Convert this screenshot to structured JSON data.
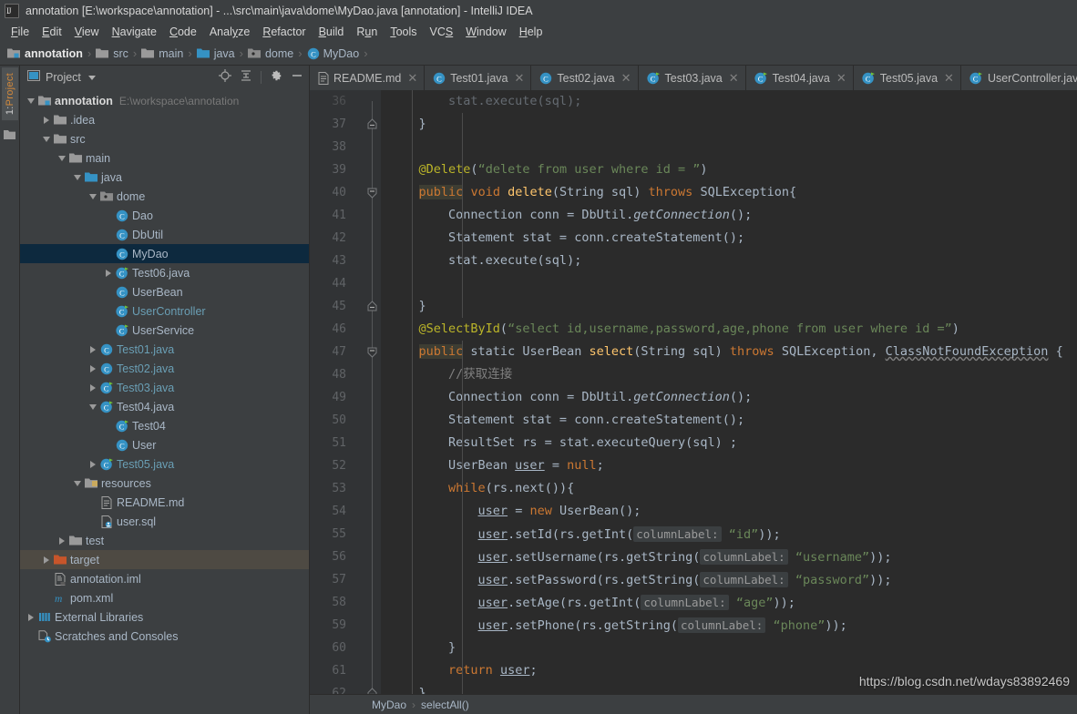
{
  "window": {
    "title": "annotation [E:\\workspace\\annotation] - ...\\src\\main\\java\\dome\\MyDao.java [annotation] - IntelliJ IDEA",
    "logo_icon": "intellij-idea-logo"
  },
  "menubar": {
    "items": [
      {
        "label": "File",
        "mnemonic": "F"
      },
      {
        "label": "Edit",
        "mnemonic": "E"
      },
      {
        "label": "View",
        "mnemonic": "V"
      },
      {
        "label": "Navigate",
        "mnemonic": "N"
      },
      {
        "label": "Code",
        "mnemonic": "C"
      },
      {
        "label": "Analyze",
        "mnemonic": "y"
      },
      {
        "label": "Refactor",
        "mnemonic": "R"
      },
      {
        "label": "Build",
        "mnemonic": "B"
      },
      {
        "label": "Run",
        "mnemonic": "u"
      },
      {
        "label": "Tools",
        "mnemonic": "T"
      },
      {
        "label": "VCS",
        "mnemonic": "S"
      },
      {
        "label": "Window",
        "mnemonic": "W"
      },
      {
        "label": "Help",
        "mnemonic": "H"
      }
    ]
  },
  "navbar": {
    "crumbs": [
      {
        "label": "annotation",
        "icon": "module-icon"
      },
      {
        "label": "src",
        "icon": "folder-icon"
      },
      {
        "label": "main",
        "icon": "folder-icon"
      },
      {
        "label": "java",
        "icon": "source-root-folder-icon"
      },
      {
        "label": "dome",
        "icon": "package-icon"
      },
      {
        "label": "MyDao",
        "icon": "class-icon"
      }
    ],
    "separator": "›"
  },
  "toolstrip": {
    "tab_number": "1:",
    "tab_label": "Project",
    "folder_icon": "folder-icon"
  },
  "project_panel": {
    "title": "Project",
    "dropdown_icon": "chevron-down-icon",
    "actions": [
      {
        "name": "locate-icon",
        "glyph": "⊕"
      },
      {
        "name": "collapse-all-icon",
        "glyph": "⤓"
      },
      {
        "name": "settings-gear-icon",
        "glyph": "⚙"
      },
      {
        "name": "hide-panel-icon",
        "glyph": "—"
      }
    ],
    "tree": [
      {
        "label": "annotation",
        "path": "E:\\workspace\\annotation",
        "depth": 0,
        "arrow": "down",
        "icon": "module-icon",
        "bold": true,
        "state": "normal"
      },
      {
        "label": ".idea",
        "depth": 1,
        "arrow": "right",
        "icon": "folder-icon",
        "state": "normal"
      },
      {
        "label": "src",
        "depth": 1,
        "arrow": "down",
        "icon": "folder-icon",
        "state": "normal"
      },
      {
        "label": "main",
        "depth": 2,
        "arrow": "down",
        "icon": "folder-icon",
        "state": "normal"
      },
      {
        "label": "java",
        "depth": 3,
        "arrow": "down",
        "icon": "source-root-folder-icon",
        "state": "normal"
      },
      {
        "label": "dome",
        "depth": 4,
        "arrow": "down",
        "icon": "package-icon",
        "state": "normal"
      },
      {
        "label": "Dao",
        "depth": 5,
        "arrow": "none",
        "icon": "class-icon",
        "state": "normal"
      },
      {
        "label": "DbUtil",
        "depth": 5,
        "arrow": "none",
        "icon": "class-icon",
        "state": "normal"
      },
      {
        "label": "MyDao",
        "depth": 5,
        "arrow": "none",
        "icon": "class-icon",
        "state": "selected"
      },
      {
        "label": "Test06.java",
        "depth": 5,
        "arrow": "right",
        "icon": "runnable-class-icon",
        "state": "normal"
      },
      {
        "label": "UserBean",
        "depth": 5,
        "arrow": "none",
        "icon": "class-icon",
        "state": "normal"
      },
      {
        "label": "UserController",
        "depth": 5,
        "arrow": "none",
        "icon": "runnable-class-icon",
        "state": "normal",
        "blue": true
      },
      {
        "label": "UserService",
        "depth": 5,
        "arrow": "none",
        "icon": "runnable-class-icon",
        "state": "normal"
      },
      {
        "label": "Test01.java",
        "depth": 4,
        "arrow": "right",
        "icon": "class-icon",
        "state": "normal",
        "blue": true
      },
      {
        "label": "Test02.java",
        "depth": 4,
        "arrow": "right",
        "icon": "class-icon",
        "state": "normal",
        "blue": true
      },
      {
        "label": "Test03.java",
        "depth": 4,
        "arrow": "right",
        "icon": "runnable-class-icon",
        "state": "normal",
        "blue": true
      },
      {
        "label": "Test04.java",
        "depth": 4,
        "arrow": "down",
        "icon": "runnable-class-icon",
        "state": "normal"
      },
      {
        "label": "Test04",
        "depth": 5,
        "arrow": "none",
        "icon": "runnable-class-icon",
        "state": "normal"
      },
      {
        "label": "User",
        "depth": 5,
        "arrow": "none",
        "icon": "class-icon",
        "state": "normal"
      },
      {
        "label": "Test05.java",
        "depth": 4,
        "arrow": "right",
        "icon": "runnable-class-icon",
        "state": "normal",
        "blue": true
      },
      {
        "label": "resources",
        "depth": 3,
        "arrow": "down",
        "icon": "resource-root-folder-icon",
        "state": "normal"
      },
      {
        "label": "README.md",
        "depth": 4,
        "arrow": "none",
        "icon": "markdown-file-icon",
        "state": "normal"
      },
      {
        "label": "user.sql",
        "depth": 4,
        "arrow": "none",
        "icon": "sql-file-icon",
        "state": "normal"
      },
      {
        "label": "test",
        "depth": 2,
        "arrow": "right",
        "icon": "folder-icon",
        "state": "normal"
      },
      {
        "label": "target",
        "depth": 1,
        "arrow": "right",
        "icon": "excluded-folder-icon",
        "state": "highlighted"
      },
      {
        "label": "annotation.iml",
        "depth": 1,
        "arrow": "none",
        "icon": "iml-file-icon",
        "state": "normal"
      },
      {
        "label": "pom.xml",
        "depth": 1,
        "arrow": "none",
        "icon": "maven-file-icon",
        "state": "normal"
      },
      {
        "label": "External Libraries",
        "depth": 0,
        "arrow": "right",
        "icon": "libraries-icon",
        "state": "normal"
      },
      {
        "label": "Scratches and Consoles",
        "depth": 0,
        "arrow": "none",
        "icon": "scratches-icon",
        "state": "normal"
      }
    ]
  },
  "editor_tabs": [
    {
      "label": "README.md",
      "icon": "markdown-file-icon",
      "active": false,
      "closable": true
    },
    {
      "label": "Test01.java",
      "icon": "class-icon",
      "active": false,
      "closable": true
    },
    {
      "label": "Test02.java",
      "icon": "class-icon",
      "active": false,
      "closable": true
    },
    {
      "label": "Test03.java",
      "icon": "runnable-class-icon",
      "active": false,
      "closable": true
    },
    {
      "label": "Test04.java",
      "icon": "runnable-class-icon",
      "active": false,
      "closable": true
    },
    {
      "label": "Test05.java",
      "icon": "runnable-class-icon",
      "active": false,
      "closable": true
    },
    {
      "label": "UserController.java",
      "icon": "runnable-class-icon",
      "active": false,
      "closable": true
    }
  ],
  "editor": {
    "first_line_number": 36,
    "lines": [
      {
        "n": 36,
        "fold": "none",
        "partial": true,
        "tokens": [
          {
            "t": "        stat.execute(sql)",
            "c": "plain"
          },
          {
            "t": ";",
            "c": "plain"
          }
        ]
      },
      {
        "n": 37,
        "fold": "end",
        "tokens": [
          {
            "t": "    }",
            "c": "plain"
          }
        ]
      },
      {
        "n": 38,
        "fold": "none",
        "tokens": []
      },
      {
        "n": 39,
        "fold": "none",
        "tokens": [
          {
            "t": "    ",
            "c": "plain"
          },
          {
            "t": "@Delete",
            "c": "anno"
          },
          {
            "t": "(",
            "c": "plain"
          },
          {
            "t": "“delete from user where id = ”",
            "c": "str"
          },
          {
            "t": ")",
            "c": "plain"
          }
        ]
      },
      {
        "n": 40,
        "fold": "start-arrow",
        "tokens": [
          {
            "t": "    ",
            "c": "plain"
          },
          {
            "t": "public",
            "c": "kw-hl"
          },
          {
            "t": " ",
            "c": "plain"
          },
          {
            "t": "void",
            "c": "kw"
          },
          {
            "t": " ",
            "c": "plain"
          },
          {
            "t": "delete",
            "c": "meth"
          },
          {
            "t": "(String sql) ",
            "c": "plain"
          },
          {
            "t": "throws",
            "c": "kw"
          },
          {
            "t": " SQLException{",
            "c": "plain"
          }
        ]
      },
      {
        "n": 41,
        "fold": "none",
        "tokens": [
          {
            "t": "        Connection conn = DbUtil.",
            "c": "plain"
          },
          {
            "t": "getConnection",
            "c": "static"
          },
          {
            "t": "()",
            "c": "plain"
          },
          {
            "t": ";",
            "c": "plain"
          }
        ]
      },
      {
        "n": 42,
        "fold": "none",
        "tokens": [
          {
            "t": "        Statement stat = conn.createStatement()",
            "c": "plain"
          },
          {
            "t": ";",
            "c": "plain"
          }
        ]
      },
      {
        "n": 43,
        "fold": "none",
        "tokens": [
          {
            "t": "        stat.execute(sql)",
            "c": "plain"
          },
          {
            "t": ";",
            "c": "plain"
          }
        ]
      },
      {
        "n": 44,
        "fold": "none",
        "tokens": []
      },
      {
        "n": 45,
        "fold": "end",
        "tokens": [
          {
            "t": "    }",
            "c": "plain"
          }
        ]
      },
      {
        "n": 46,
        "fold": "none",
        "tokens": [
          {
            "t": "    ",
            "c": "plain"
          },
          {
            "t": "@SelectById",
            "c": "anno"
          },
          {
            "t": "(",
            "c": "plain"
          },
          {
            "t": "“select id,username,password,age,phone from user where id =”",
            "c": "str"
          },
          {
            "t": ")",
            "c": "plain"
          }
        ]
      },
      {
        "n": 47,
        "fold": "start-arrow",
        "tokens": [
          {
            "t": "    ",
            "c": "plain"
          },
          {
            "t": "public",
            "c": "kw-hl"
          },
          {
            "t": " static UserBean ",
            "c": "plain"
          },
          {
            "t": "select",
            "c": "meth"
          },
          {
            "t": "(String sql) ",
            "c": "plain"
          },
          {
            "t": "throws",
            "c": "kw"
          },
          {
            "t": " SQLException, ",
            "c": "plain"
          },
          {
            "t": "ClassNotFoundException",
            "c": "warn"
          },
          {
            "t": " {",
            "c": "plain"
          }
        ]
      },
      {
        "n": 48,
        "fold": "none",
        "tokens": [
          {
            "t": "        ",
            "c": "plain"
          },
          {
            "t": "//获取连接",
            "c": "cmt"
          }
        ]
      },
      {
        "n": 49,
        "fold": "none",
        "tokens": [
          {
            "t": "        Connection conn = DbUtil.",
            "c": "plain"
          },
          {
            "t": "getConnection",
            "c": "static"
          },
          {
            "t": "()",
            "c": "plain"
          },
          {
            "t": ";",
            "c": "plain"
          }
        ]
      },
      {
        "n": 50,
        "fold": "none",
        "tokens": [
          {
            "t": "        Statement stat = conn.createStatement()",
            "c": "plain"
          },
          {
            "t": ";",
            "c": "plain"
          }
        ]
      },
      {
        "n": 51,
        "fold": "none",
        "tokens": [
          {
            "t": "        ResultSet rs = stat.executeQuery(sql) ",
            "c": "plain"
          },
          {
            "t": ";",
            "c": "plain"
          }
        ]
      },
      {
        "n": 52,
        "fold": "none",
        "tokens": [
          {
            "t": "        UserBean ",
            "c": "plain"
          },
          {
            "t": "user",
            "c": "field"
          },
          {
            "t": " = ",
            "c": "plain"
          },
          {
            "t": "null",
            "c": "kw"
          },
          {
            "t": ";",
            "c": "plain"
          }
        ]
      },
      {
        "n": 53,
        "fold": "none",
        "tokens": [
          {
            "t": "        ",
            "c": "plain"
          },
          {
            "t": "while",
            "c": "kw"
          },
          {
            "t": "(rs.next()){",
            "c": "plain"
          }
        ]
      },
      {
        "n": 54,
        "fold": "none",
        "tokens": [
          {
            "t": "            ",
            "c": "plain"
          },
          {
            "t": "user",
            "c": "field"
          },
          {
            "t": " = ",
            "c": "plain"
          },
          {
            "t": "new",
            "c": "kw"
          },
          {
            "t": " UserBean()",
            "c": "plain"
          },
          {
            "t": ";",
            "c": "plain"
          }
        ]
      },
      {
        "n": 55,
        "fold": "none",
        "tokens": [
          {
            "t": "            ",
            "c": "plain"
          },
          {
            "t": "user",
            "c": "field"
          },
          {
            "t": ".setId(rs.getInt(",
            "c": "plain"
          },
          {
            "t": "columnLabel:",
            "c": "param"
          },
          {
            "t": " ",
            "c": "plain"
          },
          {
            "t": "“id”",
            "c": "str"
          },
          {
            "t": "))",
            "c": "plain"
          },
          {
            "t": ";",
            "c": "plain"
          }
        ]
      },
      {
        "n": 56,
        "fold": "none",
        "tokens": [
          {
            "t": "            ",
            "c": "plain"
          },
          {
            "t": "user",
            "c": "field"
          },
          {
            "t": ".setUsername(rs.getString(",
            "c": "plain"
          },
          {
            "t": "columnLabel:",
            "c": "param"
          },
          {
            "t": " ",
            "c": "plain"
          },
          {
            "t": "“username”",
            "c": "str"
          },
          {
            "t": "))",
            "c": "plain"
          },
          {
            "t": ";",
            "c": "plain"
          }
        ]
      },
      {
        "n": 57,
        "fold": "none",
        "tokens": [
          {
            "t": "            ",
            "c": "plain"
          },
          {
            "t": "user",
            "c": "field"
          },
          {
            "t": ".setPassword(rs.getString(",
            "c": "plain"
          },
          {
            "t": "columnLabel:",
            "c": "param"
          },
          {
            "t": " ",
            "c": "plain"
          },
          {
            "t": "“password”",
            "c": "str"
          },
          {
            "t": "))",
            "c": "plain"
          },
          {
            "t": ";",
            "c": "plain"
          }
        ]
      },
      {
        "n": 58,
        "fold": "none",
        "tokens": [
          {
            "t": "            ",
            "c": "plain"
          },
          {
            "t": "user",
            "c": "field"
          },
          {
            "t": ".setAge(rs.getInt(",
            "c": "plain"
          },
          {
            "t": "columnLabel:",
            "c": "param"
          },
          {
            "t": " ",
            "c": "plain"
          },
          {
            "t": "“age”",
            "c": "str"
          },
          {
            "t": "))",
            "c": "plain"
          },
          {
            "t": ";",
            "c": "plain"
          }
        ]
      },
      {
        "n": 59,
        "fold": "none",
        "tokens": [
          {
            "t": "            ",
            "c": "plain"
          },
          {
            "t": "user",
            "c": "field"
          },
          {
            "t": ".setPhone(rs.getString(",
            "c": "plain"
          },
          {
            "t": "columnLabel:",
            "c": "param"
          },
          {
            "t": " ",
            "c": "plain"
          },
          {
            "t": "“phone”",
            "c": "str"
          },
          {
            "t": "))",
            "c": "plain"
          },
          {
            "t": ";",
            "c": "plain"
          }
        ]
      },
      {
        "n": 60,
        "fold": "none",
        "tokens": [
          {
            "t": "        }",
            "c": "plain"
          }
        ]
      },
      {
        "n": 61,
        "fold": "none",
        "tokens": [
          {
            "t": "        ",
            "c": "plain"
          },
          {
            "t": "return",
            "c": "kw"
          },
          {
            "t": " ",
            "c": "plain"
          },
          {
            "t": "user",
            "c": "field"
          },
          {
            "t": ";",
            "c": "plain"
          }
        ]
      },
      {
        "n": 62,
        "fold": "end",
        "tokens": [
          {
            "t": "    }",
            "c": "plain"
          }
        ]
      }
    ]
  },
  "editor_breadcrumb": {
    "items": [
      "MyDao",
      "selectAll()"
    ],
    "separator": "›"
  },
  "watermark": {
    "text": "https://blog.csdn.net/wdays83892469"
  },
  "colors": {
    "chrome_bg": "#3c3f41",
    "editor_bg": "#2b2b2b",
    "gutter_bg": "#313335",
    "selection_bg": "#0d293e",
    "highlight_bg": "#4e4a43",
    "text": "#a9b7c6",
    "keyword": "#cc7832",
    "string": "#6a8759",
    "annotation": "#bbb529",
    "method": "#ffc66d",
    "comment": "#808080",
    "accent_blue": "#3592c4",
    "accent_orange": "#d3893b"
  }
}
